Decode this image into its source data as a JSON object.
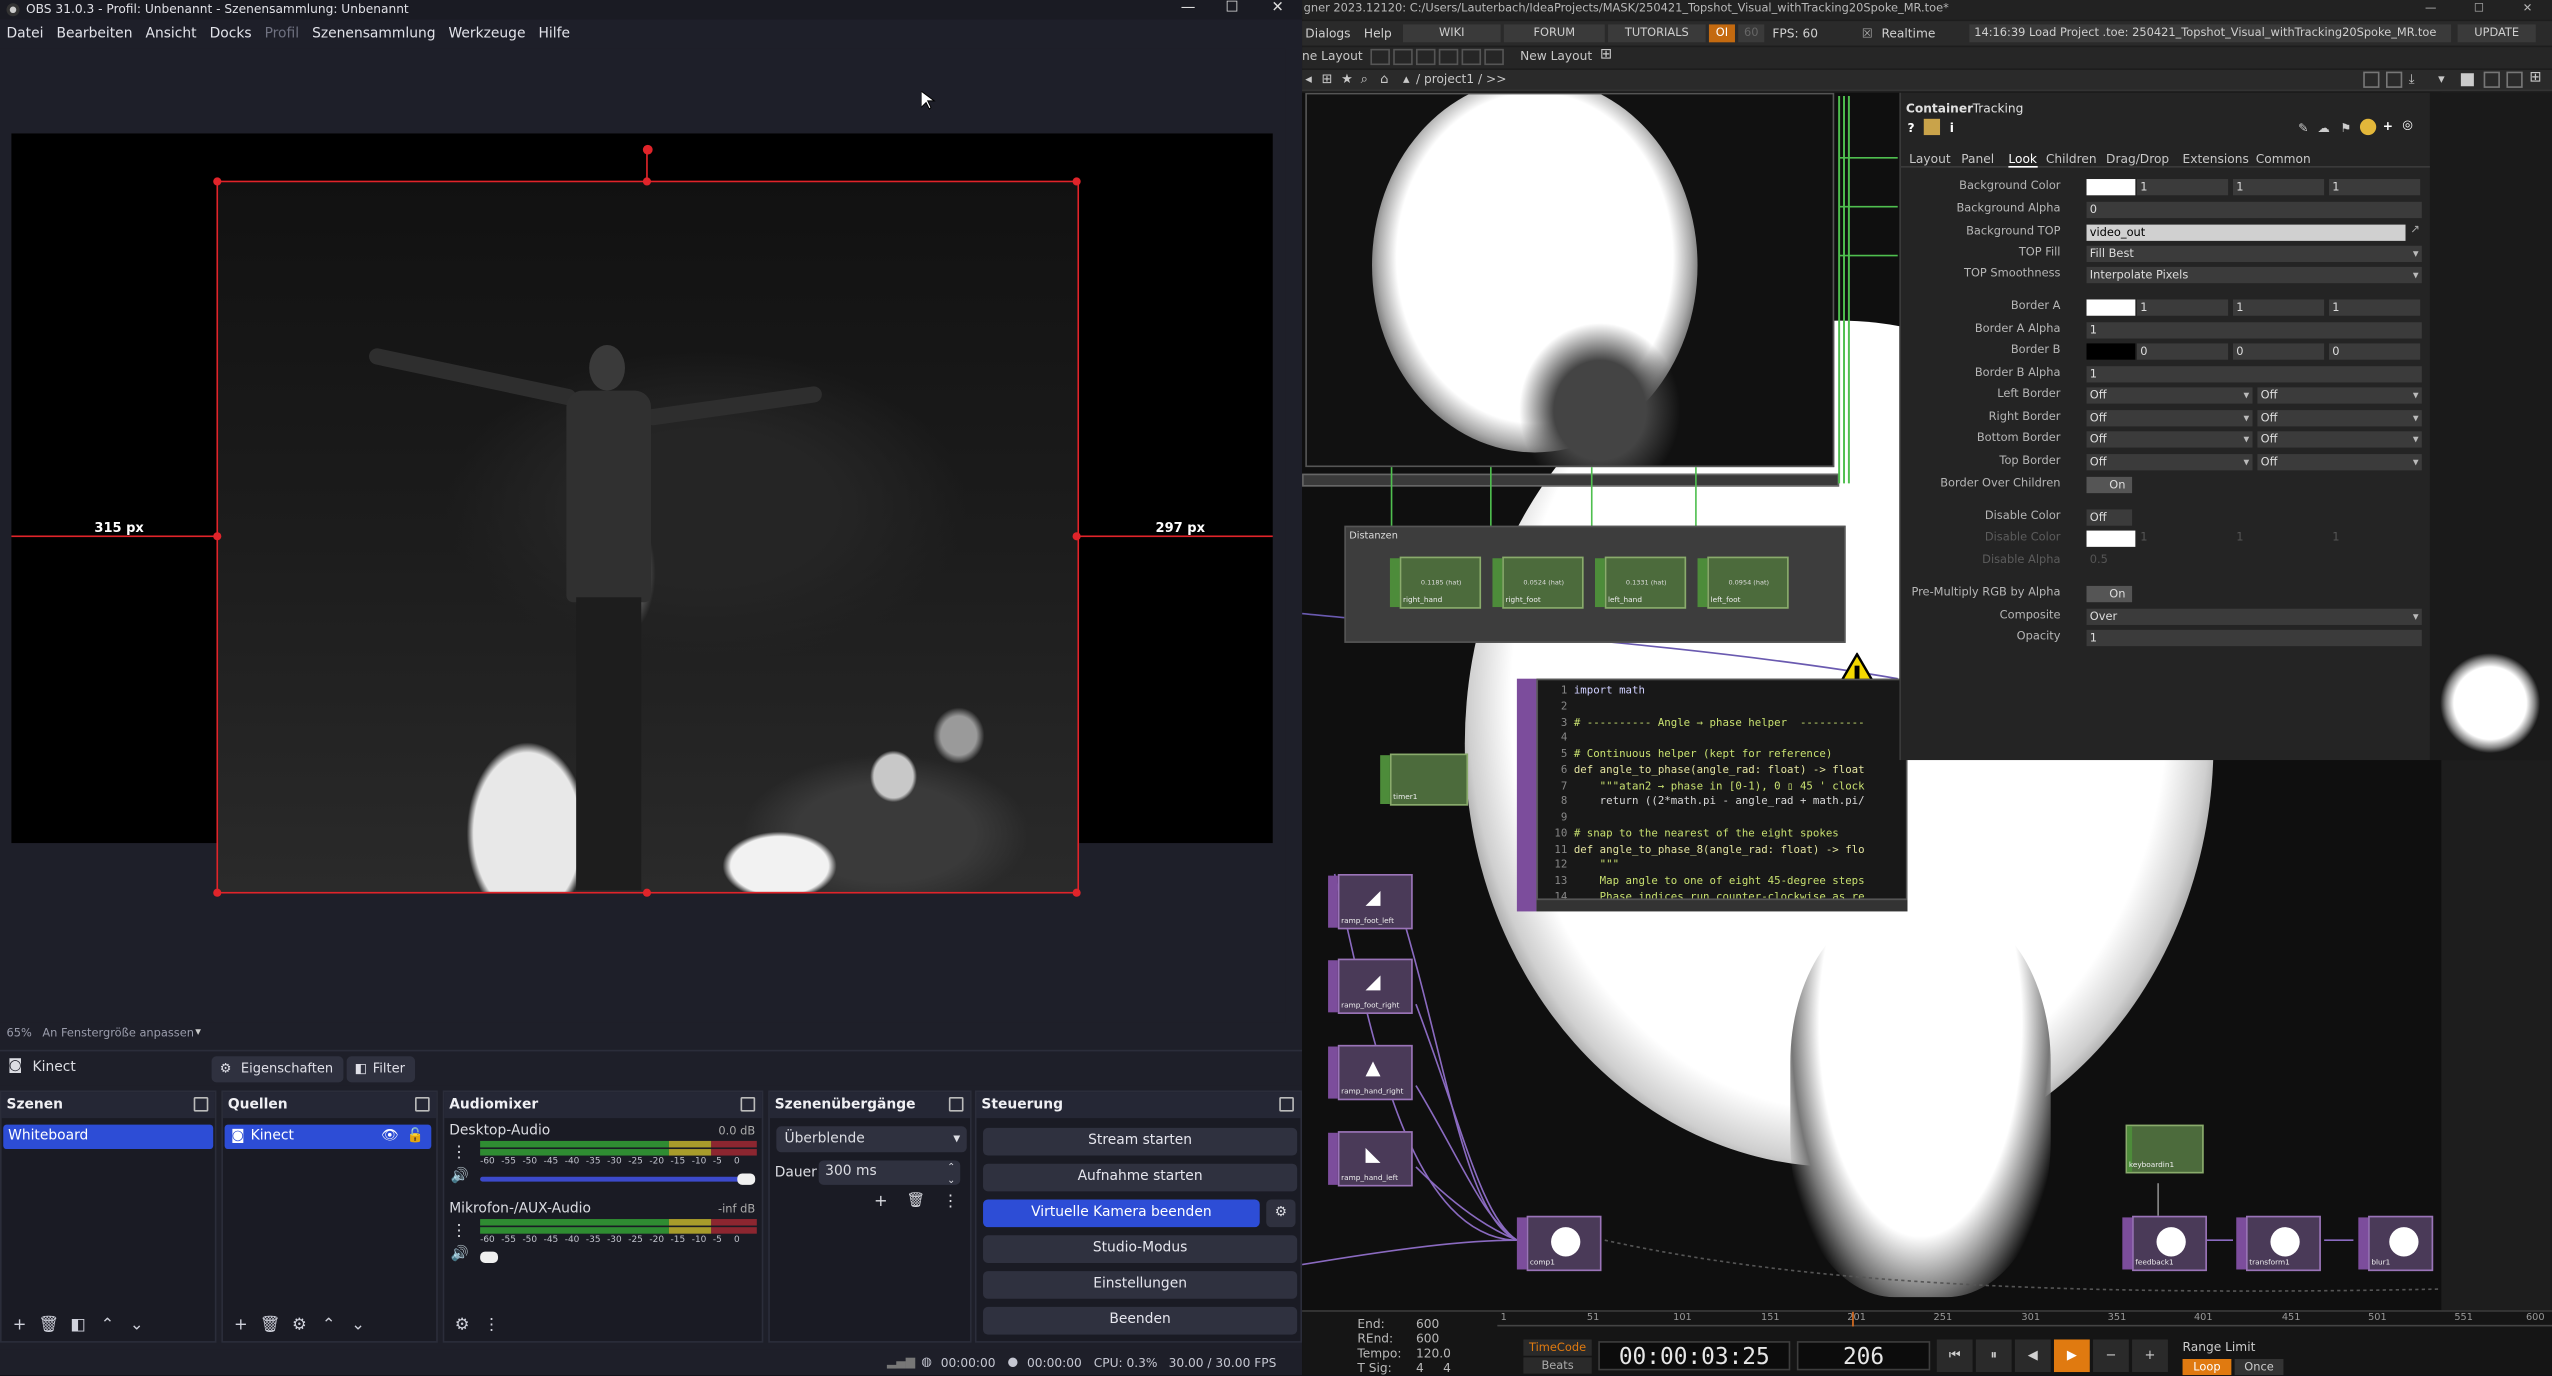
{
  "obs": {
    "title": "OBS 31.0.3 - Profil: Unbenannt - Szenensammlung: Unbenannt",
    "window_controls": [
      "—",
      "☐",
      "✕"
    ],
    "menu": [
      "Datei",
      "Bearbeiten",
      "Ansicht",
      "Docks",
      "Profil",
      "Szenensammlung",
      "Werkzeuge",
      "Hilfe"
    ],
    "preview": {
      "left_distance": "315 px",
      "right_distance": "297 px",
      "zoom": "65%",
      "fit_label": "An Fenstergröße anpassen"
    },
    "source_bar": {
      "selected_source": "Kinect",
      "properties_label": "Eigenschaften",
      "filter_label": "Filter"
    },
    "scenes": {
      "title": "Szenen",
      "items": [
        "Whiteboard"
      ]
    },
    "sources": {
      "title": "Quellen",
      "items": [
        "Kinect"
      ]
    },
    "audio": {
      "title": "Audiomixer",
      "channels": [
        {
          "name": "Desktop-Audio",
          "level": "0.0 dB",
          "volume": 1.0
        },
        {
          "name": "Mikrofon-/AUX-Audio",
          "level": "-inf dB",
          "volume": 0.05
        }
      ],
      "scale": [
        "-60",
        "-55",
        "-50",
        "-45",
        "-40",
        "-35",
        "-30",
        "-25",
        "-20",
        "-15",
        "-10",
        "-5",
        "0"
      ]
    },
    "transitions": {
      "title": "Szenenübergänge",
      "selected": "Überblende",
      "duration_label": "Dauer",
      "duration_value": "300 ms"
    },
    "controls": {
      "title": "Steuerung",
      "buttons": [
        "Stream starten",
        "Aufnahme starten",
        "Virtuelle Kamera beenden",
        "Studio-Modus",
        "Einstellungen",
        "Beenden"
      ]
    },
    "status": {
      "stream_time": "00:00:00",
      "rec_time": "00:00:00",
      "cpu": "CPU: 0.3%",
      "fps": "30.00 / 30.00 FPS"
    }
  },
  "td": {
    "title": "gner 2023.12120: C:/Users/Lauterbach/IdeaProjects/MASK/250421_Topshot_Visual_withTracking20Spoke_MR.toe*",
    "menu": [
      "Dialogs",
      "Help"
    ],
    "toolbar": {
      "wiki": "WIKI",
      "forum": "FORUM",
      "tutorials": "TUTORIALS",
      "oi": "OI",
      "sixty": "60",
      "fps": "FPS:  60",
      "realtime": "Realtime",
      "log": "14:16:39 Load Project .toe: 250421_Topshot_Visual_withTracking20Spoke_MR.toe",
      "update": "UPDATE"
    },
    "layout": {
      "ne_layout": "ne Layout",
      "new_layout": "New Layout"
    },
    "path": "/ project1 / >>",
    "distanzen": {
      "title": "Distanzen",
      "ops": [
        {
          "name": "right_hand",
          "value": "0.1185 (hat)"
        },
        {
          "name": "right_foot",
          "value": "0.0524 (hat)"
        },
        {
          "name": "left_hand",
          "value": "0.1331 (hat)"
        },
        {
          "name": "left_foot",
          "value": "0.0954 (hat)"
        }
      ]
    },
    "ops": {
      "timer": "timer1",
      "ramp_foot_left": "ramp_foot_left",
      "ramp_foot_right": "ramp_foot_right",
      "ramp_hand_right": "ramp_hand_right",
      "ramp_hand_left": "ramp_hand_left",
      "comp": "comp1",
      "keyboard": "keyboardin1",
      "feedback": "feedback1",
      "transform": "transform1",
      "blur": "blur1"
    },
    "code": {
      "lines": [
        "import math",
        "",
        "# ---------- Angle → phase helper  ----------",
        "",
        "# Continuous helper (kept for reference)",
        "def angle_to_phase(angle_rad: float) -> float",
        "    \"\"\"atan2 → phase in [0-1), 0 ▯ 45 ' clock",
        "    return ((2*math.pi - angle_rad + math.pi/",
        "",
        "# snap to the nearest of the eight spokes",
        "def angle_to_phase_8(angle_rad: float) -> flo",
        "    \"\"\"",
        "    Map angle to one of eight 45-degree steps",
        "    Phase indices run counter-clockwise as re"
      ]
    },
    "params": {
      "op_type": "Container",
      "op_name": "Tracking",
      "tabs": [
        "Layout",
        "Panel",
        "Look",
        "Children",
        "Drag/Drop",
        "Extensions",
        "Common"
      ],
      "active_tab": "Look",
      "rows": {
        "bg_color": {
          "label": "Background Color",
          "v": [
            "1",
            "1",
            "1"
          ]
        },
        "bg_alpha": {
          "label": "Background Alpha",
          "v": "0"
        },
        "bg_top": {
          "label": "Background TOP",
          "v": "video_out"
        },
        "top_fill": {
          "label": "TOP Fill",
          "v": "Fill Best"
        },
        "top_smooth": {
          "label": "TOP Smoothness",
          "v": "Interpolate Pixels"
        },
        "border_a": {
          "label": "Border A",
          "v": [
            "1",
            "1",
            "1"
          ]
        },
        "border_a_alpha": {
          "label": "Border A Alpha",
          "v": "1"
        },
        "border_b": {
          "label": "Border B",
          "v": [
            "0",
            "0",
            "0"
          ]
        },
        "border_b_alpha": {
          "label": "Border B Alpha",
          "v": "1"
        },
        "left_border": {
          "label": "Left Border",
          "v": [
            "Off",
            "Off"
          ]
        },
        "right_border": {
          "label": "Right Border",
          "v": [
            "Off",
            "Off"
          ]
        },
        "bottom_border": {
          "label": "Bottom Border",
          "v": [
            "Off",
            "Off"
          ]
        },
        "top_border": {
          "label": "Top Border",
          "v": [
            "Off",
            "Off"
          ]
        },
        "border_over": {
          "label": "Border Over Children",
          "v": "On"
        },
        "disable_color": {
          "label": "Disable Color",
          "v": "Off"
        },
        "disable_color2": {
          "label": "Disable Color",
          "v": [
            "1",
            "1",
            "1"
          ]
        },
        "disable_alpha": {
          "label": "Disable Alpha",
          "v": "0.5"
        },
        "premultiply": {
          "label": "Pre-Multiply RGB by Alpha",
          "v": "On"
        },
        "composite": {
          "label": "Composite",
          "v": "Over"
        },
        "opacity": {
          "label": "Opacity",
          "v": "1"
        }
      }
    },
    "timeline": {
      "end_label": "End:",
      "end": "600",
      "rend_label": "REnd:",
      "rend": "600",
      "tempo_label": "Tempo:",
      "tempo": "120.0",
      "tsig_label": "T Sig:",
      "tsig": "4     4",
      "timecode_label": "TimeCode",
      "beats_label": "Beats",
      "timecode": "00:00:03:25",
      "frame": "206",
      "range_limit": "Range Limit",
      "loop": "Loop",
      "once": "Once",
      "ruler": [
        "1",
        "51",
        "101",
        "151",
        "201",
        "251",
        "301",
        "351",
        "401",
        "451",
        "501",
        "551",
        "600"
      ]
    }
  }
}
